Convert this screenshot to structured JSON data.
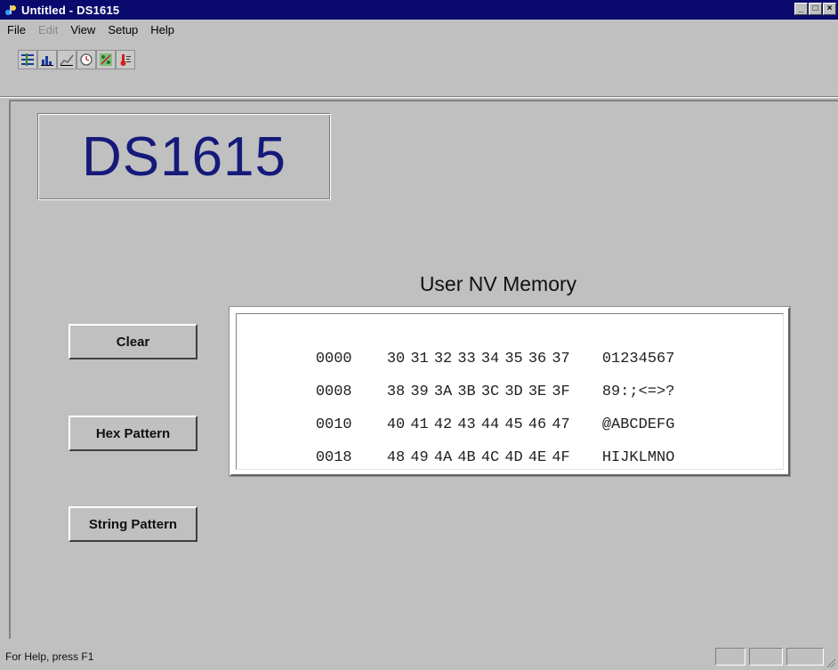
{
  "window": {
    "title": "Untitled - DS1615",
    "controls": [
      "minimize-icon",
      "maximize-icon",
      "close-icon"
    ]
  },
  "menu": [
    "File",
    "Edit",
    "View",
    "Setup",
    "Help"
  ],
  "menu_disabled": [
    "Edit"
  ],
  "toolbar": {
    "icons": [
      "temperature-log-icon",
      "histogram-icon",
      "line-graph-icon",
      "clock-icon",
      "percent-icon",
      "thermometer-icon"
    ]
  },
  "device": {
    "name": "DS1615"
  },
  "memory": {
    "title": "User NV Memory",
    "rows": [
      {
        "addr": "0000",
        "bytes": [
          "30",
          "31",
          "32",
          "33",
          "34",
          "35",
          "36",
          "37"
        ],
        "ascii": "01234567"
      },
      {
        "addr": "0008",
        "bytes": [
          "38",
          "39",
          "3A",
          "3B",
          "3C",
          "3D",
          "3E",
          "3F"
        ],
        "ascii": "89:;<=>?"
      },
      {
        "addr": "0010",
        "bytes": [
          "40",
          "41",
          "42",
          "43",
          "44",
          "45",
          "46",
          "47"
        ],
        "ascii": "@ABCDEFG"
      },
      {
        "addr": "0018",
        "bytes": [
          "48",
          "49",
          "4A",
          "4B",
          "4C",
          "4D",
          "4E",
          "4F"
        ],
        "ascii": "HIJKLMNO"
      }
    ]
  },
  "buttons": {
    "clear": "Clear",
    "hex_pattern": "Hex Pattern",
    "string_pattern": "String Pattern"
  },
  "status": {
    "text": "For Help, press F1"
  },
  "colors": {
    "title_bar": "#0a0a6e",
    "device_text": "#151a7a",
    "face": "#c0c0c0"
  }
}
